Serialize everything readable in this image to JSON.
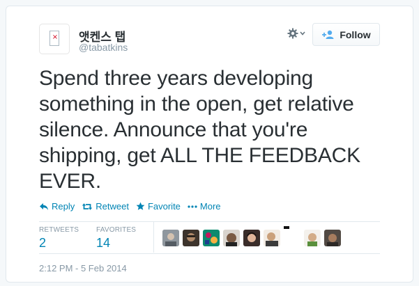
{
  "author": {
    "name": "앳켄스 탭",
    "handle": "@tabatkins"
  },
  "follow_button": {
    "label": "Follow"
  },
  "tweet": {
    "text": "Spend three years developing something in the open, get relative silence. Announce that you're shipping, get ALL THE FEEDBACK EVER."
  },
  "actions": {
    "reply": "Reply",
    "retweet": "Retweet",
    "favorite": "Favorite",
    "more": "More"
  },
  "stats": {
    "retweets_label": "RETWEETS",
    "retweets_count": "2",
    "favorites_label": "FAVORITES",
    "favorites_count": "14"
  },
  "timestamp": "2:12 PM - 5 Feb 2014",
  "colors": {
    "link": "#0084b4",
    "text": "#292f33",
    "muted": "#8899a6",
    "border": "#e1e8ed"
  },
  "icons": {
    "avatar": "broken-image-icon",
    "settings": "gear-icon",
    "follow": "add-user-icon",
    "reply": "reply-icon",
    "retweet": "retweet-icon",
    "favorite": "star-icon",
    "more": "ellipsis-icon"
  }
}
